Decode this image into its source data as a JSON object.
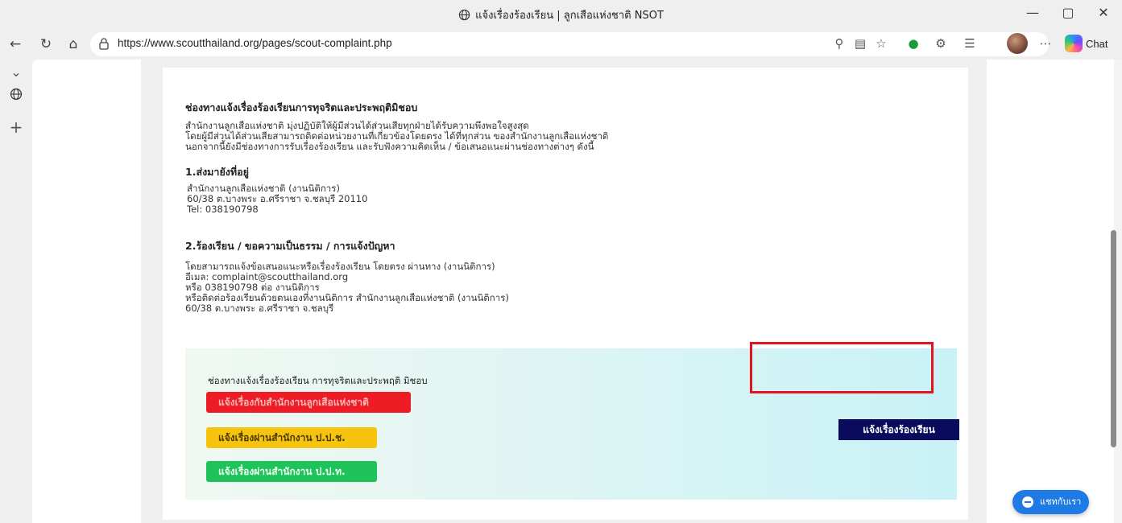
{
  "window": {
    "title": "แจ้งเรื่องร้องเรียน | ลูกเสือแห่งชาติ NSOT",
    "minimize": "—",
    "restore": "▢",
    "close": "✕"
  },
  "toolbar": {
    "url": "https://www.scoutthailand.org/pages/scout-complaint.php",
    "chat_label": "Chat"
  },
  "content": {
    "heading": "ช่องทางแจ้งเรื่องร้องเรียนการทุจริตและประพฤติมิชอบ",
    "intro": [
      "สำนักงานลูกเสือแห่งชาติ มุ่งปฏิบัติให้ผู้มีส่วนได้ส่วนเสียทุกฝ่ายได้รับความพึงพอใจสูงสุด",
      "โดยผู้มีส่วนได้ส่วนเสียสามารถติดต่อหน่วยงานที่เกี่ยวข้องโดยตรง ได้ที่ทุกส่วน ของสำนักงานลูกเสือแห่งชาติ",
      "นอกจากนี้ยังมีช่องทางการรับเรื่องร้องเรียน และรับฟังความคิดเห็น / ข้อเสนอแนะผ่านช่องทางต่างๆ ดังนี้"
    ],
    "section1_title": "1.ส่งมายังที่อยู่",
    "address": [
      "สำนักงานลูกเสือแห่งชาติ (งานนิติการ)",
      "60/38 ต.บางพระ อ.ศรีราชา จ.ชลบุรี 20110",
      "Tel: 038190798"
    ],
    "section2_title": "2.ร้องเรียน / ขอความเป็นธรรม / การแจ้งปัญหา",
    "contact": [
      "โดยสามารถแจ้งข้อเสนอแนะหรือเรื่องร้องเรียน โดยตรง ผ่านทาง (งานนิติการ)",
      "อีเมล: complaint@scoutthailand.org",
      "หรือ 038190798 ต่อ งานนิติการ",
      "หรือติดต่อร้องเรียนด้วยตนเองที่งานนิติการ สำนักงานลูกเสือแห่งชาติ (งานนิติการ)",
      "60/38 ต.บางพระ อ.ศรีราชา จ.ชลบุรี"
    ],
    "panel": {
      "title": "ช่องทางแจ้งเรื่องร้องเรียน การทุจริตและประพฤติ มิชอบ",
      "btn_red": "แจ้งเรื่องกับสำนักงานลูกเสือแห่งชาติ",
      "btn_yellow": "แจ้งเรื่องผ่านสำนักงาน ป.ป.ช.",
      "btn_green": "แจ้งเรื่องผ่านสำนักงาน ป.ป.ท.",
      "report_btn": "แจ้งเรื่องร้องเรียน"
    },
    "chat_float": "แชทกับเรา"
  },
  "colors": {
    "red": "#ee1c25",
    "yellow": "#f6c40e",
    "green": "#1ec35a",
    "navy": "#0b0b5e",
    "highlight": "#e3141b",
    "chat_blue": "#1e7be6"
  }
}
